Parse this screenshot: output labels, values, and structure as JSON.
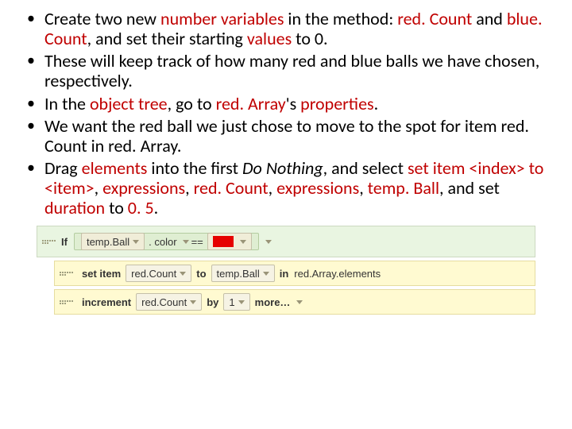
{
  "bullets": [
    {
      "pre": "Create two new ",
      "hl1": "number variables ",
      "mid1": "in the method: ",
      "hl2": "red. Count ",
      "mid2": "and ",
      "hl3": "blue. Count",
      "mid3": ", and set their starting ",
      "hl4": "values",
      "tail": " to 0."
    },
    {
      "text": "These will keep track of how many red and blue balls we have chosen, respectively."
    },
    {
      "pre": "In the ",
      "hl1": "object tree",
      "mid1": ", go to ",
      "hl2": "red. Array",
      "mid2": "'s ",
      "hl3": "properties",
      "tail": "."
    },
    {
      "text": "We want the red ball we just chose to move to the spot for item red. Count in red. Array."
    },
    {
      "pre": "Drag ",
      "hl1": "elements ",
      "mid1": "into the first ",
      "em1": "Do Nothing",
      "mid2": ", and select ",
      "hl2": "set item <index> to <item>",
      "mid3": ", ",
      "hl3": "expressions",
      "mid4": ", ",
      "hl4": "red. Count",
      "mid5": ", ",
      "hl5": "expressions",
      "mid6": ", ",
      "hl6": "temp. Ball",
      "mid7": ", and set ",
      "hl7": "duration",
      "mid8": " to ",
      "hl8": "0. 5",
      "tail": "."
    }
  ],
  "code": {
    "if_kw": "If",
    "tempBall": "temp.Ball",
    "dot_color": ". color",
    "eq": "==",
    "set_item": "set item",
    "redCount": "red.Count",
    "to": "to",
    "in": "in",
    "redArrayElements": "red.Array.elements",
    "increment": "increment",
    "by": "by",
    "one": "1",
    "more": "more…"
  }
}
